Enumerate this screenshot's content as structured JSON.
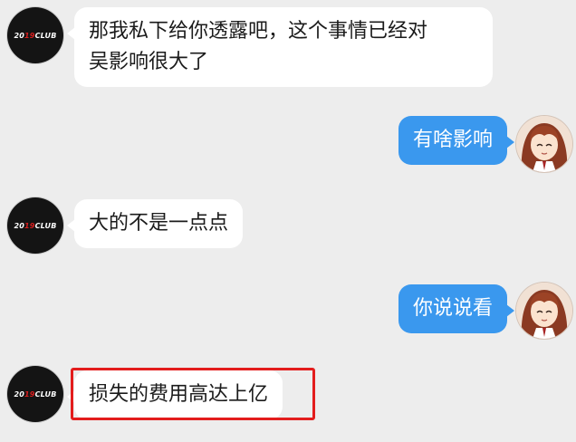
{
  "chat": {
    "messages": [
      {
        "side": "left",
        "sender": "2019CLUB",
        "lines": [
          "那我私下给你透露吧，这个事情已经对",
          "吴影响很大了"
        ]
      },
      {
        "side": "right",
        "sender": "anime-girl",
        "lines": [
          "有啥影响"
        ]
      },
      {
        "side": "left",
        "sender": "2019CLUB",
        "lines": [
          "大的不是一点点"
        ]
      },
      {
        "side": "right",
        "sender": "anime-girl",
        "lines": [
          "你说说看"
        ]
      },
      {
        "side": "left",
        "sender": "2019CLUB",
        "lines": [
          "损失的费用高达上亿"
        ],
        "highlighted": true,
        "highlight_color": "#e31d1d"
      }
    ],
    "left_avatar": {
      "logo_prefix": "20",
      "logo_accent": "19",
      "logo_suffix": "CLUB",
      "icon": "club-logo-avatar-icon"
    },
    "right_avatar": {
      "icon": "anime-girl-avatar-icon"
    }
  },
  "colors": {
    "background": "#ededed",
    "incoming_bubble": "#ffffff",
    "outgoing_bubble": "#3a98ee",
    "highlight": "#e31d1d"
  }
}
